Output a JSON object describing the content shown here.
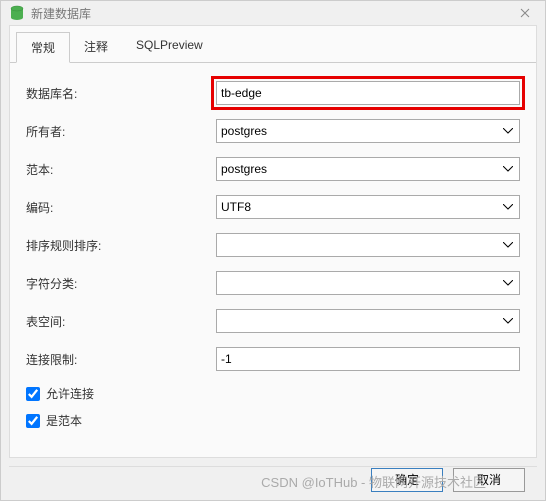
{
  "titlebar": {
    "title": "新建数据库"
  },
  "tabs": [
    {
      "label": "常规",
      "active": true
    },
    {
      "label": "注释",
      "active": false
    },
    {
      "label": "SQLPreview",
      "active": false
    }
  ],
  "fields": {
    "dbname": {
      "label": "数据库名:",
      "value": "tb-edge"
    },
    "owner": {
      "label": "所有者:",
      "value": "postgres"
    },
    "template": {
      "label": "范本:",
      "value": "postgres"
    },
    "encoding": {
      "label": "编码:",
      "value": "UTF8"
    },
    "collation": {
      "label": "排序规则排序:",
      "value": ""
    },
    "ctype": {
      "label": "字符分类:",
      "value": ""
    },
    "tablespace": {
      "label": "表空间:",
      "value": ""
    },
    "connlimit": {
      "label": "连接限制:",
      "value": "-1"
    }
  },
  "checkboxes": {
    "allowconn": {
      "label": "允许连接",
      "checked": true
    },
    "istemplate": {
      "label": "是范本",
      "checked": true
    }
  },
  "buttons": {
    "ok": "确定",
    "cancel": "取消"
  },
  "watermark": "CSDN @IoTHub - 物联网开源技术社区"
}
